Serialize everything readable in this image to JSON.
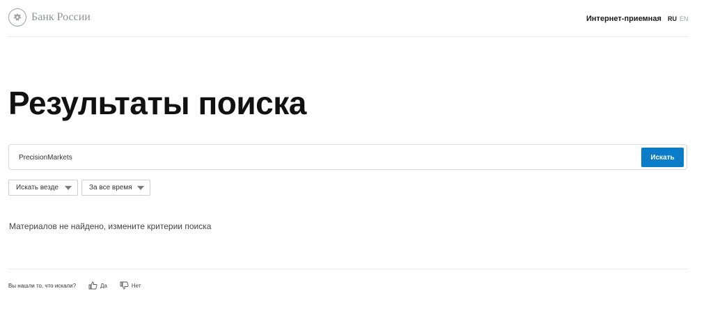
{
  "header": {
    "logo_text": "Банк России",
    "reception_link": "Интернет-приемная",
    "lang_ru": "RU",
    "lang_en": "EN"
  },
  "main": {
    "title": "Результаты поиска",
    "search": {
      "value": "PrecisionMarkets",
      "button_label": "Искать"
    },
    "filters": [
      {
        "label": "Искать везде"
      },
      {
        "label": "За все время"
      }
    ],
    "no_results_text": "Материалов не найдено, измените критерии поиска"
  },
  "feedback": {
    "question": "Вы нашли то, что искали?",
    "yes_label": "Да",
    "no_label": "Нет"
  },
  "colors": {
    "accent": "#0a7cc8",
    "muted": "#8e9399"
  }
}
